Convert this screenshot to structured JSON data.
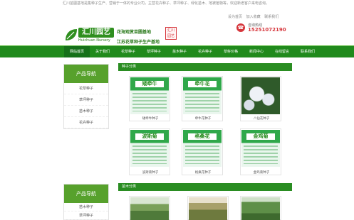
{
  "header": {
    "intro": "汇川苗圃基地是集种子生产、营销于一体的专业公司，主营花卉种子、草坪种子、绿化苗木、地被植物等，欢迎新老客户来电咨询。",
    "logo_name": "汇川园艺",
    "logo_sub1": "花海观赏苗圃基地",
    "logo_sub2": "Huichuan Nursery",
    "logo_sub3": "江苏花草种子生产基地",
    "seal_text": "汇川园艺",
    "toplinks": [
      "设为首页",
      "加入收藏",
      "联系我们"
    ],
    "phone_label": "咨询热线",
    "phone_number": "15251072190"
  },
  "nav": {
    "items": [
      "网站首页",
      "关于我们",
      "花草种子",
      "草坪种子",
      "苗木种子",
      "花卉种子",
      "草籽价格",
      "新闻中心",
      "在线留言",
      "联系我们"
    ],
    "active_index": 0
  },
  "sidebar": {
    "box1": {
      "title": "产品导航",
      "items": [
        "花草种子",
        "草坪种子",
        "苗木种子",
        "花卉种子"
      ]
    },
    "box2": {
      "title": "产品导航",
      "items": [
        "苗木种子",
        "草坪种子"
      ]
    }
  },
  "main": {
    "section1_title": "种子分类",
    "section2_title": "苗木分类",
    "products": [
      {
        "tag": "矮牵牛",
        "caption": "矮牵牛种子"
      },
      {
        "tag": "牵牛花",
        "caption": "牵牛花种子"
      },
      {
        "tag": "",
        "caption": "八仙花种子"
      },
      {
        "tag": "波斯菊",
        "caption": "波斯菊种子"
      },
      {
        "tag": "格桑花",
        "caption": "格桑花种子"
      },
      {
        "tag": "金鸡菊",
        "caption": "金鸡菊种子"
      }
    ]
  },
  "colors": {
    "nav_green": "#208a1c",
    "side_head_green": "#57a12c",
    "phone_red": "#d6363c"
  }
}
